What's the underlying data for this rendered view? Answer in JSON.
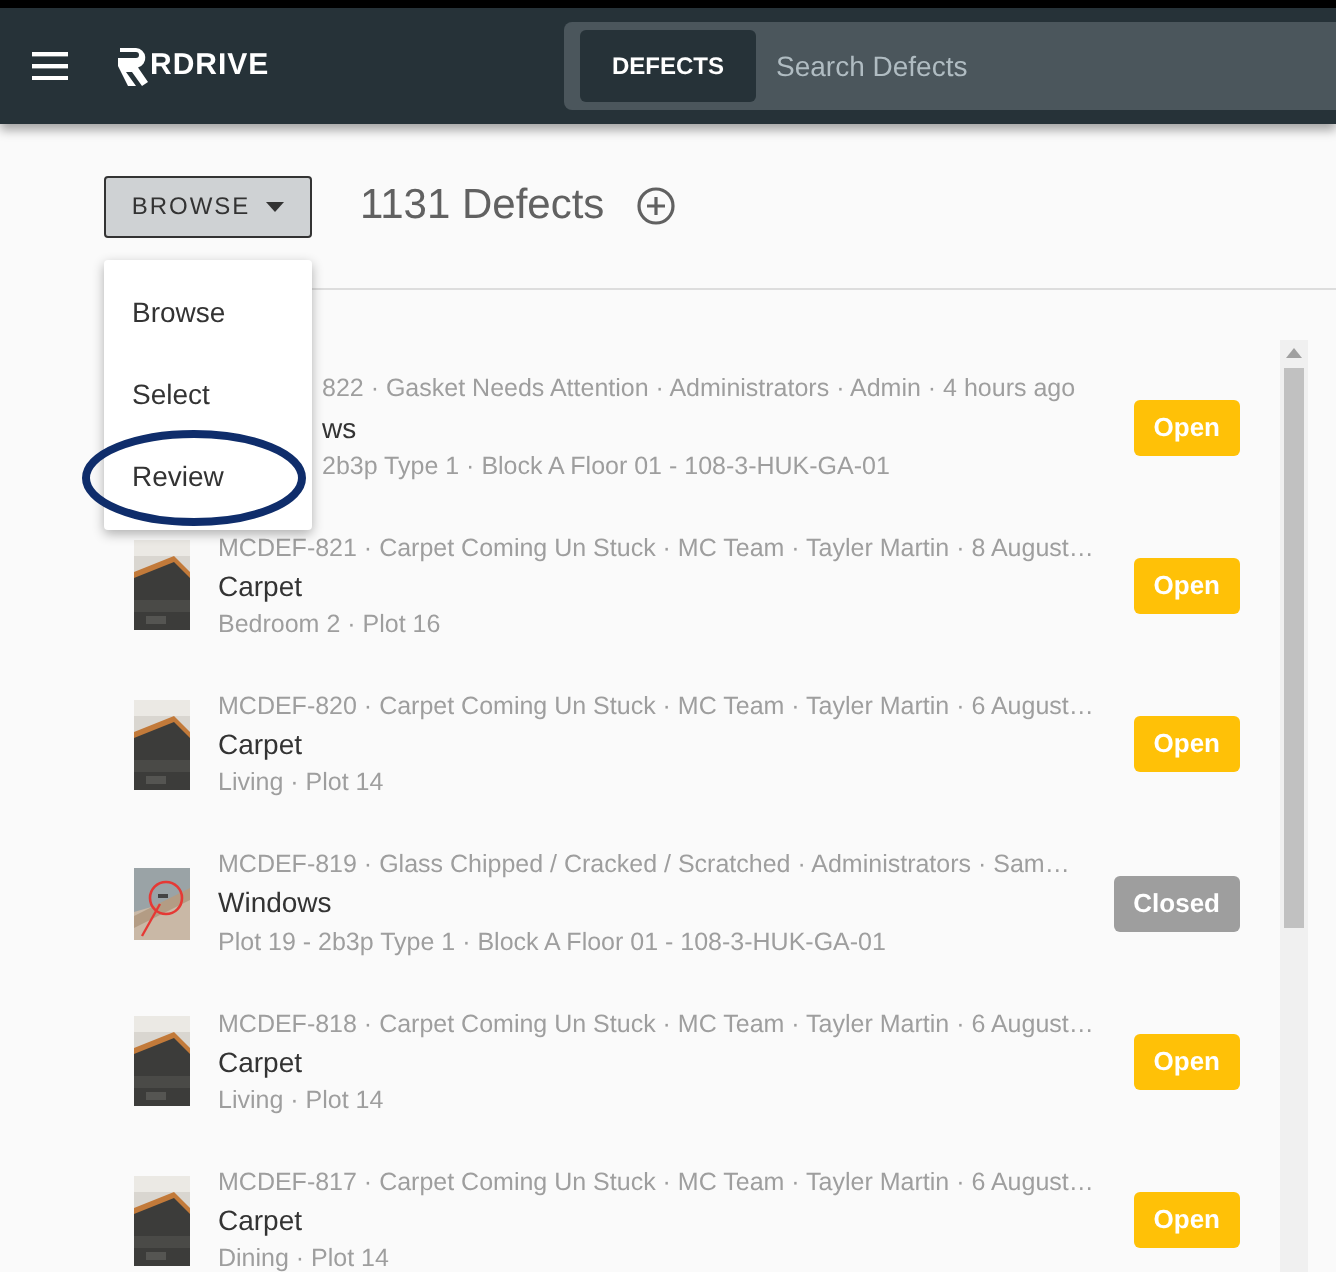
{
  "navbar": {
    "brand": "RDRIVE",
    "search": {
      "scope": "DEFECTS",
      "placeholder": "Search Defects"
    }
  },
  "toolbar": {
    "mode_button": "BROWSE",
    "count": "1131 Defects"
  },
  "mode_menu": {
    "items": [
      {
        "label": "Browse",
        "circled": false
      },
      {
        "label": "Select",
        "circled": false
      },
      {
        "label": "Review",
        "circled": true
      }
    ]
  },
  "defects": [
    {
      "meta": "822 · Gasket Needs Attention · Administrators · Admin · 4 hours ago",
      "title": "ws",
      "location": "2b3p Type 1 · Block A Floor 01 - 108-3-HUK-GA-01",
      "status": {
        "label": "Open",
        "kind": "open"
      }
    },
    {
      "meta": "MCDEF-821 · Carpet Coming Un Stuck · MC Team · Tayler Martin · 8 August…",
      "title": "Carpet",
      "location": "Bedroom 2 · Plot 16",
      "status": {
        "label": "Open",
        "kind": "open"
      }
    },
    {
      "meta": "MCDEF-820 · Carpet Coming Un Stuck · MC Team · Tayler Martin · 6 August…",
      "title": "Carpet",
      "location": "Living · Plot 14",
      "status": {
        "label": "Open",
        "kind": "open"
      }
    },
    {
      "meta": "MCDEF-819 · Glass Chipped / Cracked / Scratched · Administrators · Sam…",
      "title": "Windows",
      "location": "Plot 19 - 2b3p Type 1 · Block A Floor 01 - 108-3-HUK-GA-01",
      "status": {
        "label": "Closed",
        "kind": "closed"
      }
    },
    {
      "meta": "MCDEF-818 · Carpet Coming Un Stuck · MC Team · Tayler Martin · 6 August…",
      "title": "Carpet",
      "location": "Living · Plot 14",
      "status": {
        "label": "Open",
        "kind": "open"
      }
    },
    {
      "meta": "MCDEF-817 · Carpet Coming Un Stuck · MC Team · Tayler Martin · 6 August…",
      "title": "Carpet",
      "location": "Dining · Plot 14",
      "status": {
        "label": "Open",
        "kind": "open"
      }
    }
  ]
}
